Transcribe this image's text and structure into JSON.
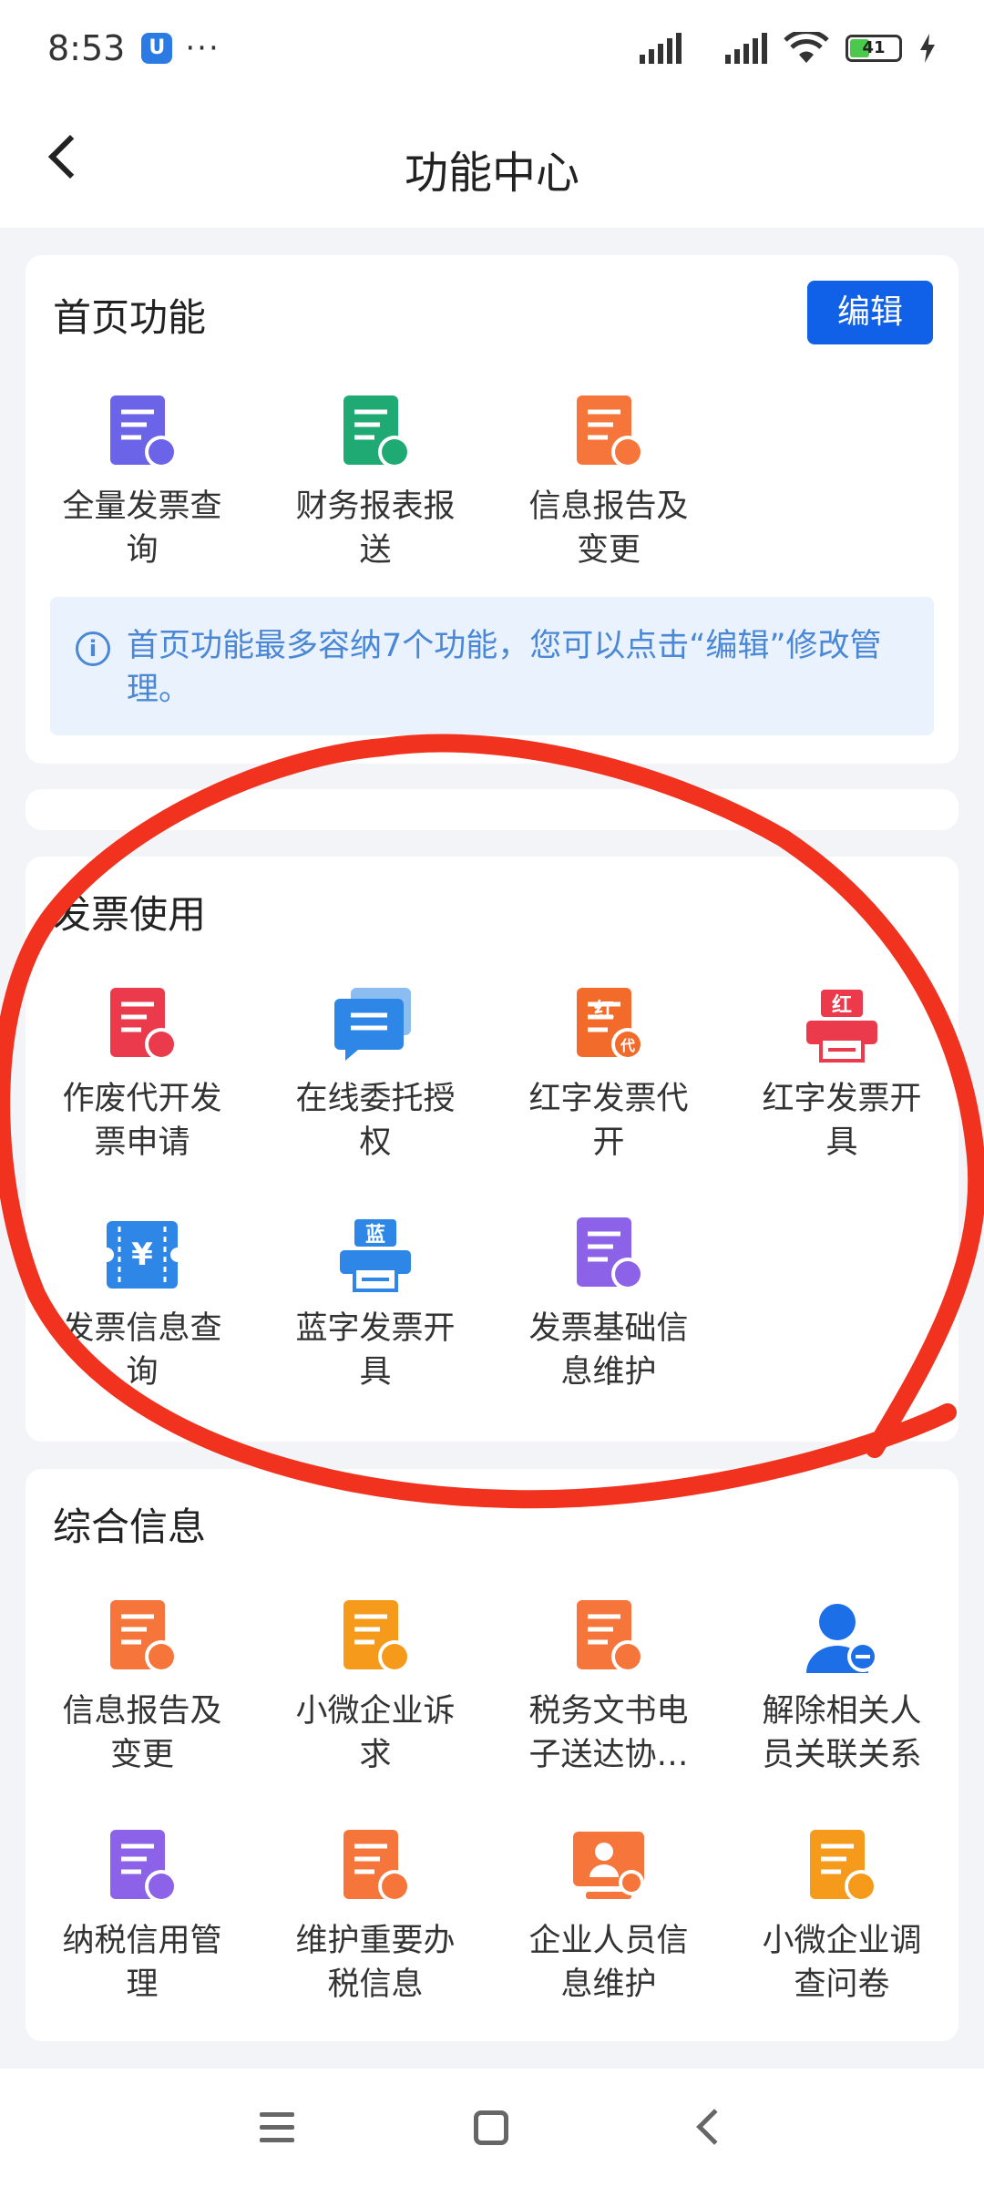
{
  "status_bar": {
    "time": "8:53",
    "app_badge": "U",
    "dots": "···",
    "battery": "41"
  },
  "header": {
    "title": "功能中心"
  },
  "home_section": {
    "title": "首页功能",
    "edit_label": "编辑",
    "items": [
      {
        "label": "全量发票查询",
        "icon": "invoice-search-icon",
        "color": "#6b63e8"
      },
      {
        "label": "财务报表报送",
        "icon": "financial-report-icon",
        "color": "#1faa73"
      },
      {
        "label": "信息报告及变更",
        "icon": "info-report-edit-icon",
        "color": "#f5753a"
      }
    ],
    "notice": "首页功能最多容纳7个功能，您可以点击“编辑”修改管理。"
  },
  "invoice_section": {
    "title": "发票使用",
    "items": [
      {
        "label": "作废代开发票申请",
        "icon": "void-invoice-icon",
        "color": "#ea3a4b"
      },
      {
        "label": "在线委托授权",
        "icon": "online-delegation-icon",
        "color": "#2e86e6"
      },
      {
        "label": "红字发票代开",
        "icon": "red-invoice-agent-icon",
        "color": "#f26b2a",
        "glyph": "红",
        "sub": "代"
      },
      {
        "label": "红字发票开具",
        "icon": "red-invoice-printer-icon",
        "color": "#ea3a4b",
        "glyph": "红"
      },
      {
        "label": "发票信息查询",
        "icon": "invoice-ticket-icon",
        "color": "#2e86e6",
        "glyph": "¥"
      },
      {
        "label": "蓝字发票开具",
        "icon": "blue-invoice-printer-icon",
        "color": "#2e86e6",
        "glyph": "蓝"
      },
      {
        "label": "发票基础信息维护",
        "icon": "invoice-maintenance-icon",
        "color": "#8c63e8"
      }
    ]
  },
  "general_section": {
    "title": "综合信息",
    "items": [
      {
        "label": "信息报告及变更",
        "icon": "info-report-edit-icon",
        "color": "#f5753a"
      },
      {
        "label": "小微企业诉求",
        "icon": "sme-appeal-icon",
        "color": "#f59a1a"
      },
      {
        "label": "税务文书电子送达协…",
        "icon": "tax-document-delivery-icon",
        "color": "#f5753a"
      },
      {
        "label": "解除相关人员关联关系",
        "icon": "remove-person-icon",
        "color": "#1c6fe6"
      },
      {
        "label": "纳税信用管理",
        "icon": "tax-credit-icon",
        "color": "#8c63e8"
      },
      {
        "label": "维护重要办税信息",
        "icon": "tax-info-maintenance-icon",
        "color": "#f5753a"
      },
      {
        "label": "企业人员信息维护",
        "icon": "staff-info-icon",
        "color": "#f5753a"
      },
      {
        "label": "小微企业调查问卷",
        "icon": "sme-survey-icon",
        "color": "#f59a1a"
      }
    ]
  }
}
